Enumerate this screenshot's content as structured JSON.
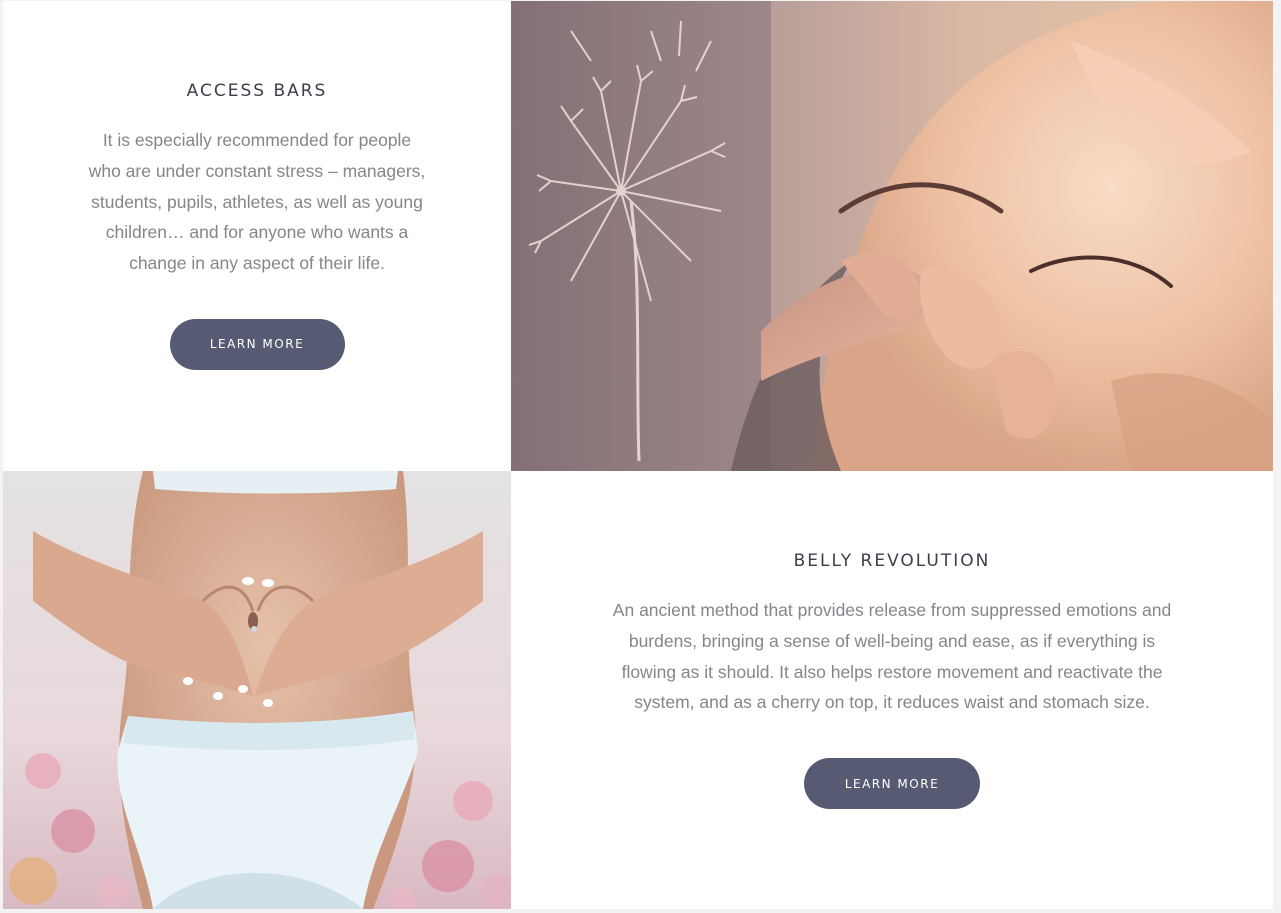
{
  "sections": [
    {
      "title": "ACCESS BARS",
      "description": "It is especially recommended for people who are under constant stress – managers, students, pupils, athletes, as well as young children… and for anyone who wants a change in any aspect of their life.",
      "button_label": "LEARN MORE"
    },
    {
      "title": "BELLY REVOLUTION",
      "description": "An ancient method that provides release from suppressed emotions and burdens, bringing a sense of well-being and ease, as if everything is flowing as it should. It also helps restore movement and reactivate the system, and as a cherry on top, it reduces waist and stomach size.",
      "button_label": "LEARN MORE"
    }
  ],
  "images": {
    "head_massage": "face-massage-with-dandelion-image",
    "belly_heart": "hands-heart-on-belly-image"
  },
  "colors": {
    "button_bg": "#575a73",
    "button_text": "#ffffff",
    "title": "#3c3f4a",
    "body_text": "#85858b",
    "panel_bg": "#ffffff"
  }
}
